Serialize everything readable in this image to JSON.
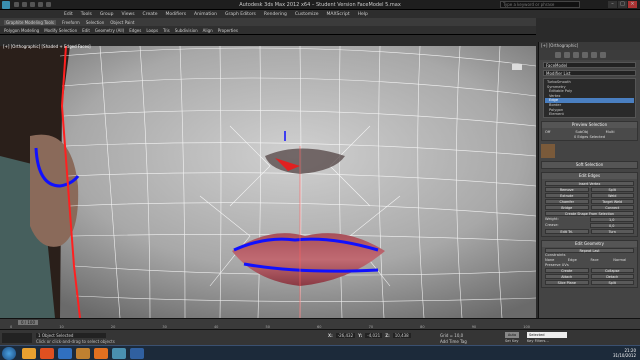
{
  "window": {
    "title": "Autodesk 3ds Max 2012 x64 – Student Version    FaceModel 5.max",
    "search_placeholder": "Type a keyword or phrase"
  },
  "menu": [
    "Edit",
    "Tools",
    "Group",
    "Views",
    "Create",
    "Modifiers",
    "Animation",
    "Graph Editors",
    "Rendering",
    "Customize",
    "MAXScript",
    "Help"
  ],
  "ribbon": {
    "tabs": [
      "Graphite Modeling Tools",
      "Freeform",
      "Selection",
      "Object Paint"
    ],
    "tools": [
      "Polygon Modeling",
      "Modify Selection",
      "Edit",
      "Geometry (All)",
      "Edges",
      "Loops",
      "Tris",
      "Subdivision",
      "Align",
      "Properties"
    ]
  },
  "viewport": {
    "label": "[+] [Orthographic] [Shaded + Edged Faces]"
  },
  "command_panel": {
    "viewport_label": "[+] [Orthographic]",
    "object_name": "FaceModel",
    "modifier_list": "Modifier List",
    "stack": [
      "TurboSmooth",
      "Symmetry",
      "Editable Poly",
      "Vertex",
      "Edge",
      "Border",
      "Polygon",
      "Element"
    ],
    "stack_selected_index": 4,
    "preview_selection": {
      "title": "Preview Selection",
      "options": [
        "Off",
        "SubObj",
        "Multi"
      ],
      "status": "0 Edges Selected"
    },
    "soft_selection": "Soft Selection",
    "edit_edges": {
      "title": "Edit Edges",
      "rows": [
        [
          "Insert Vertex"
        ],
        [
          "Remove",
          "Split"
        ],
        [
          "Extrude",
          "Weld"
        ],
        [
          "Chamfer",
          "Target Weld"
        ],
        [
          "Bridge",
          "Connect"
        ],
        [
          "Create Shape From Selection"
        ]
      ],
      "fields": [
        {
          "label": "Weight:",
          "value": "1,0"
        },
        {
          "label": "Crease:",
          "value": "0,0"
        }
      ],
      "last": [
        "Edit Tri.",
        "Turn"
      ]
    },
    "edit_geometry": {
      "title": "Edit Geometry",
      "repeat": "Repeat Last",
      "constraints_label": "Constraints",
      "constraints": [
        "None",
        "Edge",
        "Face",
        "Normal"
      ],
      "preserve": "Preserve UVs",
      "rows": [
        [
          "Create",
          "Collapse"
        ],
        [
          "Attach",
          "Detach"
        ],
        [
          "Slice Plane",
          "Split"
        ]
      ]
    }
  },
  "timeline": {
    "frame": "0 / 100",
    "ticks": [
      "0",
      "10",
      "20",
      "30",
      "40",
      "50",
      "60",
      "70",
      "80",
      "90",
      "100"
    ]
  },
  "status": {
    "selection": "1 Object Selected",
    "prompt": "Click or click-and-drag to select objects",
    "x_label": "X:",
    "x": "-26,432",
    "y_label": "Y:",
    "y": "-4,021",
    "z_label": "Z:",
    "z": "10,438",
    "grid": "Grid = 10,0",
    "add_time_tag": "Add Time Tag",
    "auto_key": "Auto Key",
    "selected": "Selected",
    "set_key": "Set Key",
    "key_filters": "Key Filters..."
  },
  "taskbar": {
    "time": "21:20",
    "date": "31/10/2012"
  },
  "colors": {
    "edge_selection": "#1010ff",
    "open_edge": "#ff2020",
    "stack_highlight": "#4a7fc1",
    "taskbar": "#1c2a3a"
  }
}
